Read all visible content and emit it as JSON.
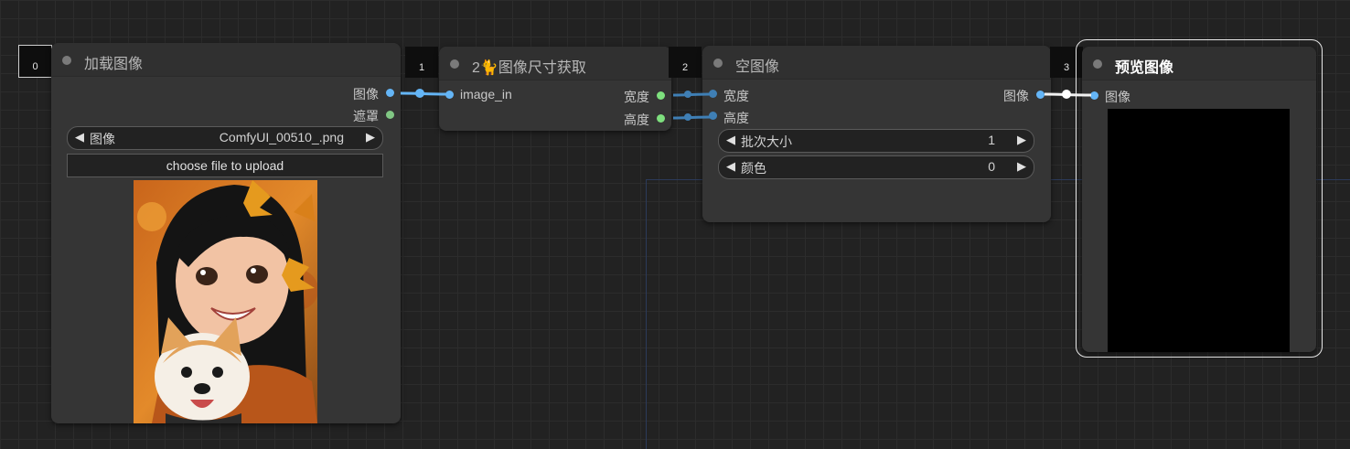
{
  "nodes": {
    "load_image": {
      "id": "0",
      "title": "加载图像",
      "outputs": [
        "图像",
        "遮罩"
      ],
      "widget_image": {
        "label": "图像",
        "value": "ComfyUI_00510_.png",
        "prev": "◀",
        "next": "▶"
      },
      "upload_button": "choose file to upload"
    },
    "get_size": {
      "id": "1",
      "title": "2🐈图像尺寸获取",
      "input": "image_in",
      "outputs": [
        "宽度",
        "高度"
      ]
    },
    "empty_image": {
      "id": "2",
      "title": "空图像",
      "inputs": [
        "宽度",
        "高度"
      ],
      "output": "图像",
      "widgets": [
        {
          "label": "批次大小",
          "value": "1",
          "prev": "◀",
          "next": "▶"
        },
        {
          "label": "颜色",
          "value": "0",
          "prev": "◀",
          "next": "▶"
        }
      ]
    },
    "preview": {
      "id": "3",
      "title": "预览图像",
      "input": "图像"
    }
  },
  "colors": {
    "image_slot": "#64b5f6",
    "int_slot": "#3f7fb5",
    "mask_slot": "#81c784",
    "size_out_slot": "#7ee07e",
    "selected_border": "#e8e8e8"
  }
}
